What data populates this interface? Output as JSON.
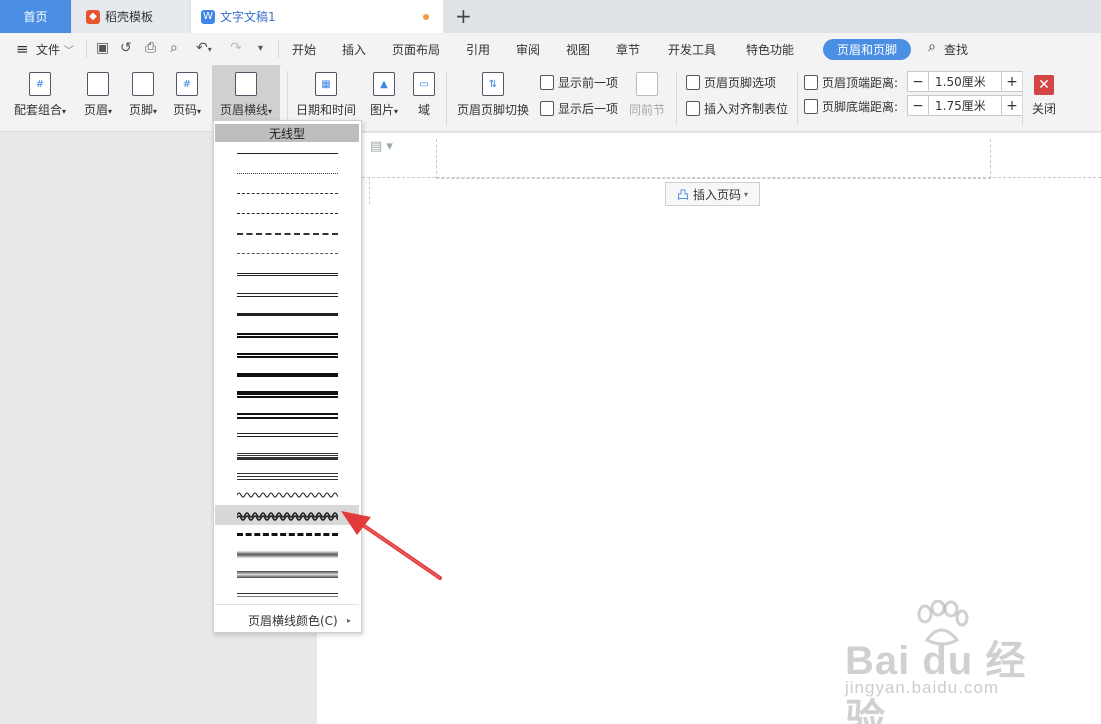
{
  "tabs": {
    "home": "首页",
    "template": "稻壳模板",
    "doc": "文字文稿1",
    "doc_icon_letter": "W"
  },
  "menu": {
    "file": "文件",
    "items": [
      "开始",
      "插入",
      "页面布局",
      "引用",
      "审阅",
      "视图",
      "章节",
      "开发工具",
      "特色功能"
    ],
    "active": "页眉和页脚",
    "find": "查找"
  },
  "ribbon": {
    "peitao": "配套组合",
    "header": "页眉",
    "footer": "页脚",
    "pagenum": "页码",
    "headerline": "页眉横线",
    "datetime": "日期和时间",
    "picture": "图片",
    "field": "域",
    "switch": "页眉页脚切换",
    "prev": "显示前一项",
    "next": "显示后一项",
    "same": "同前节",
    "options": "页眉页脚选项",
    "align_tab": "插入对齐制表位",
    "top_dist_label": "页眉顶端距离:",
    "top_dist_value": "1.50厘米",
    "bottom_dist_label": "页脚底端距离:",
    "bottom_dist_value": "1.75厘米",
    "close": "关闭"
  },
  "document": {
    "insert_page_number": "插入页码"
  },
  "dropdown": {
    "title": "无线型",
    "color_item": "页眉横线颜色(C)"
  },
  "watermark": {
    "brand": "Bai du 经验",
    "url": "jingyan.baidu.com"
  },
  "colors": {
    "accent": "#4a8fe3",
    "close": "#d64545",
    "arrow": "#e23a3a"
  }
}
